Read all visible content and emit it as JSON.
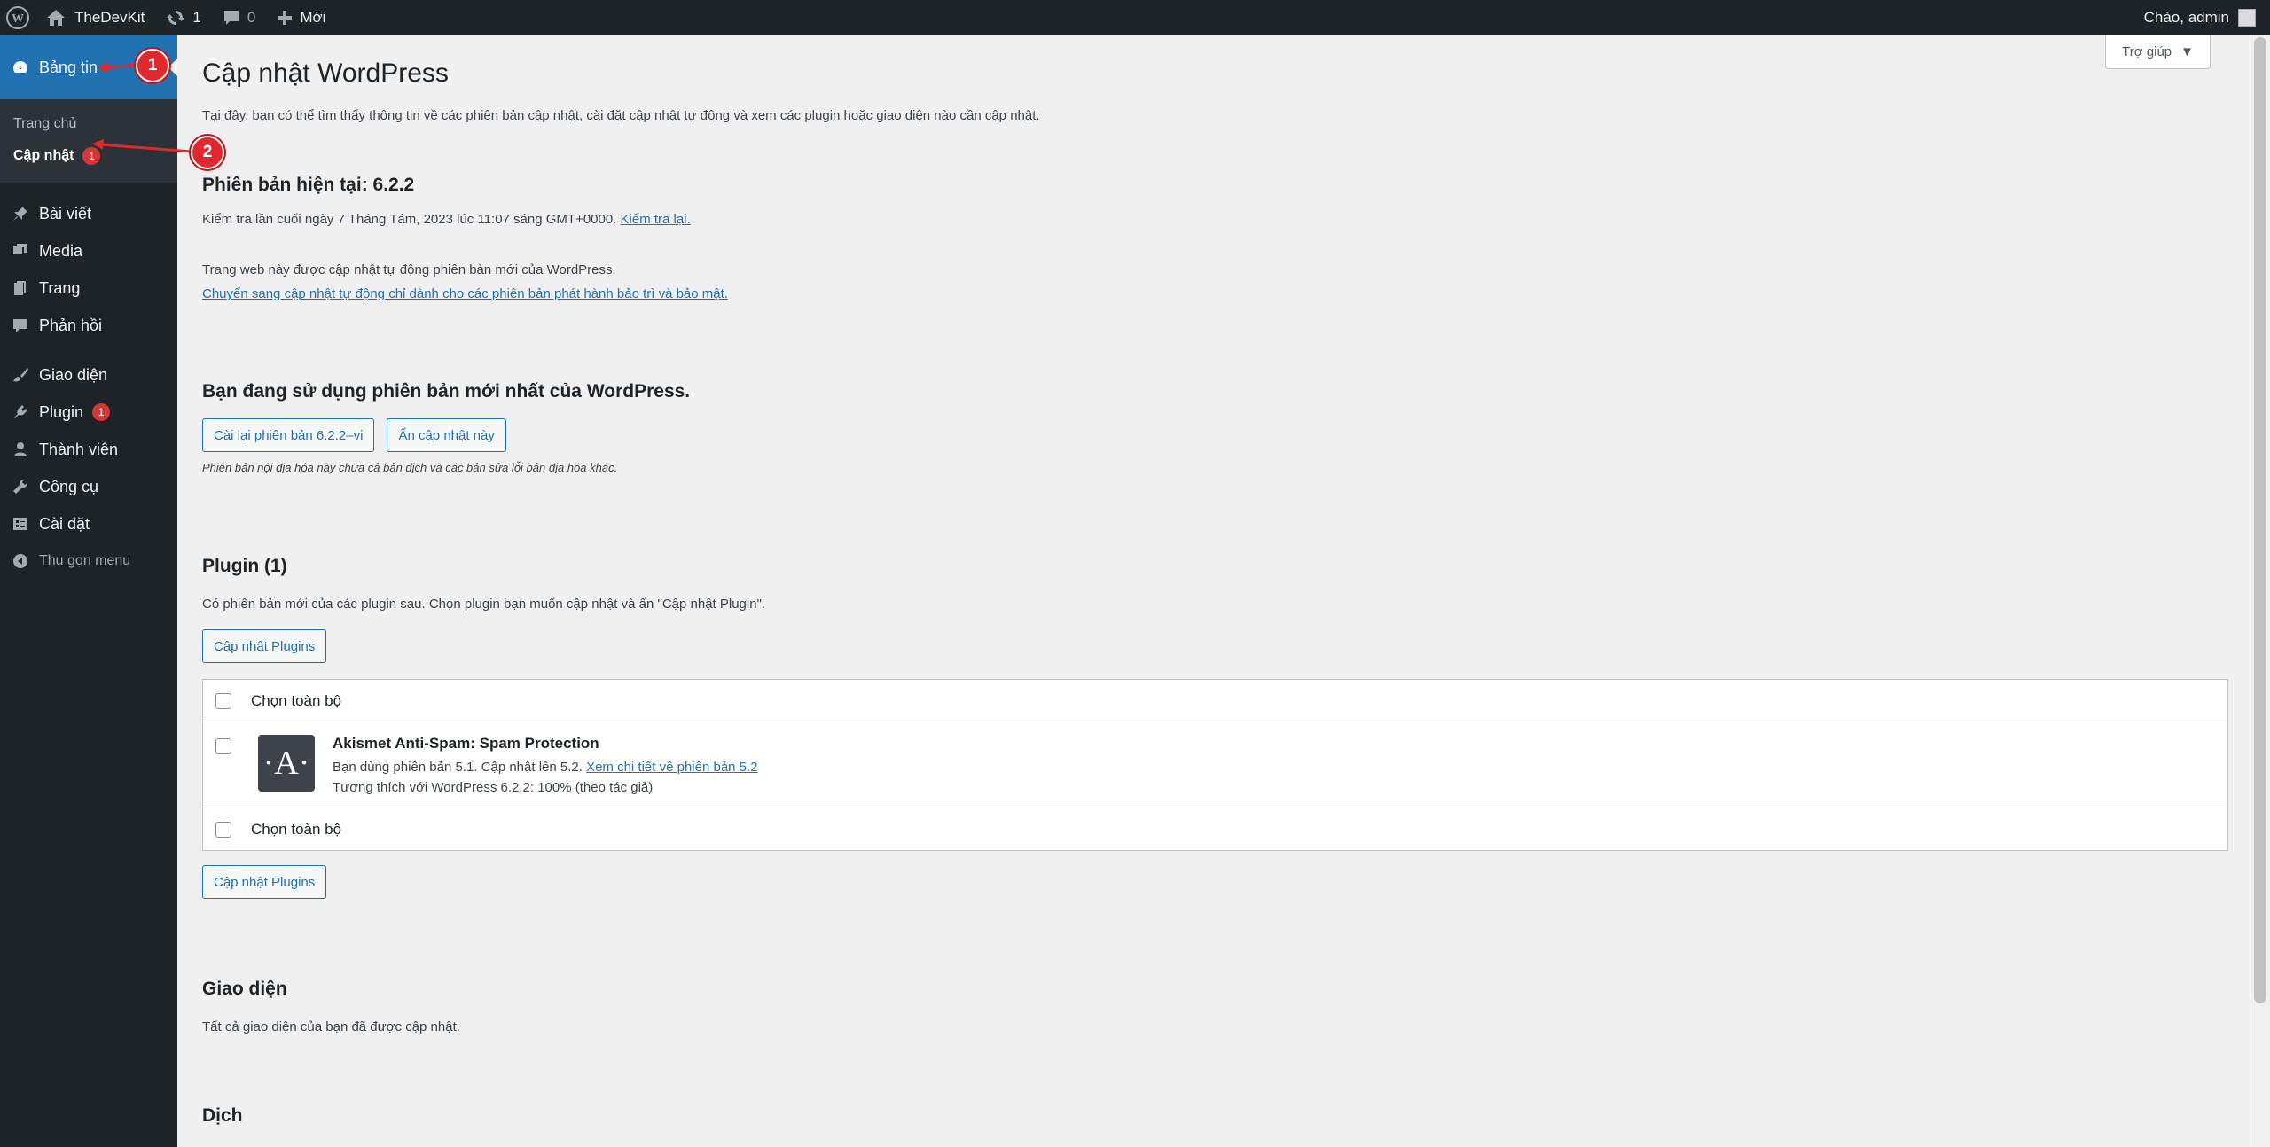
{
  "adminbar": {
    "site_name": "TheDevKit",
    "updates_count": "1",
    "comments_count": "0",
    "new_label": "Mới",
    "greeting": "Chào, admin"
  },
  "sidebar": {
    "dashboard": "Bảng tin",
    "home": "Trang chủ",
    "updates": "Cập nhật",
    "updates_badge": "1",
    "posts": "Bài viết",
    "media": "Media",
    "pages": "Trang",
    "comments": "Phản hồi",
    "appearance": "Giao diện",
    "plugins": "Plugin",
    "plugins_badge": "1",
    "users": "Thành viên",
    "tools": "Công cụ",
    "settings": "Cài đặt",
    "collapse": "Thu gọn menu"
  },
  "markers": {
    "one": "1",
    "two": "2"
  },
  "help_tab": "Trợ giúp",
  "page": {
    "title": "Cập nhật WordPress",
    "intro": "Tại đây, bạn có thể tìm thấy thông tin về các phiên bản cập nhật, cài đặt cập nhật tự động và xem các plugin hoặc giao diện nào cần cập nhật."
  },
  "current": {
    "heading": "Phiên bản hiện tại: 6.2.2",
    "last_checked": "Kiểm tra lần cuối ngày 7 Tháng Tám, 2023 lúc 11:07 sáng GMT+0000.",
    "check_again": "Kiểm tra lại.",
    "auto_update": "Trang web này được cập nhật tự động phiên bản mới của WordPress.",
    "switch_link": "Chuyển sang cập nhật tự động chỉ dành cho các phiên bản phát hành bảo trì và bảo mật."
  },
  "latest": {
    "heading": "Bạn đang sử dụng phiên bản mới nhất của WordPress.",
    "reinstall_button": "Cài lại phiên bản 6.2.2–vi",
    "hide_button": "Ẩn cập nhật này",
    "note": "Phiên bản nội địa hóa này chứa cả bản dịch và các bản sửa lỗi bản địa hóa khác."
  },
  "plugins": {
    "heading": "Plugin (1)",
    "desc": "Có phiên bản mới của các plugin sau. Chọn plugin bạn muốn cập nhật và ấn \"Cập nhật Plugin\".",
    "update_button": "Cập nhật Plugins",
    "select_all": "Chọn toàn bộ",
    "item": {
      "logo": "·A·",
      "name": "Akismet Anti-Spam: Spam Protection",
      "version_text": "Bạn dùng phiên bản 5.1. Cập nhật lên 5.2.",
      "details_link": "Xem chi tiết về phiên bản 5.2",
      "compat": "Tương thích với WordPress 6.2.2: 100% (theo tác giả)"
    }
  },
  "themes": {
    "heading": "Giao diện",
    "desc": "Tất cả giao diện của bạn đã được cập nhật."
  },
  "bottom_heading": "Dịch"
}
